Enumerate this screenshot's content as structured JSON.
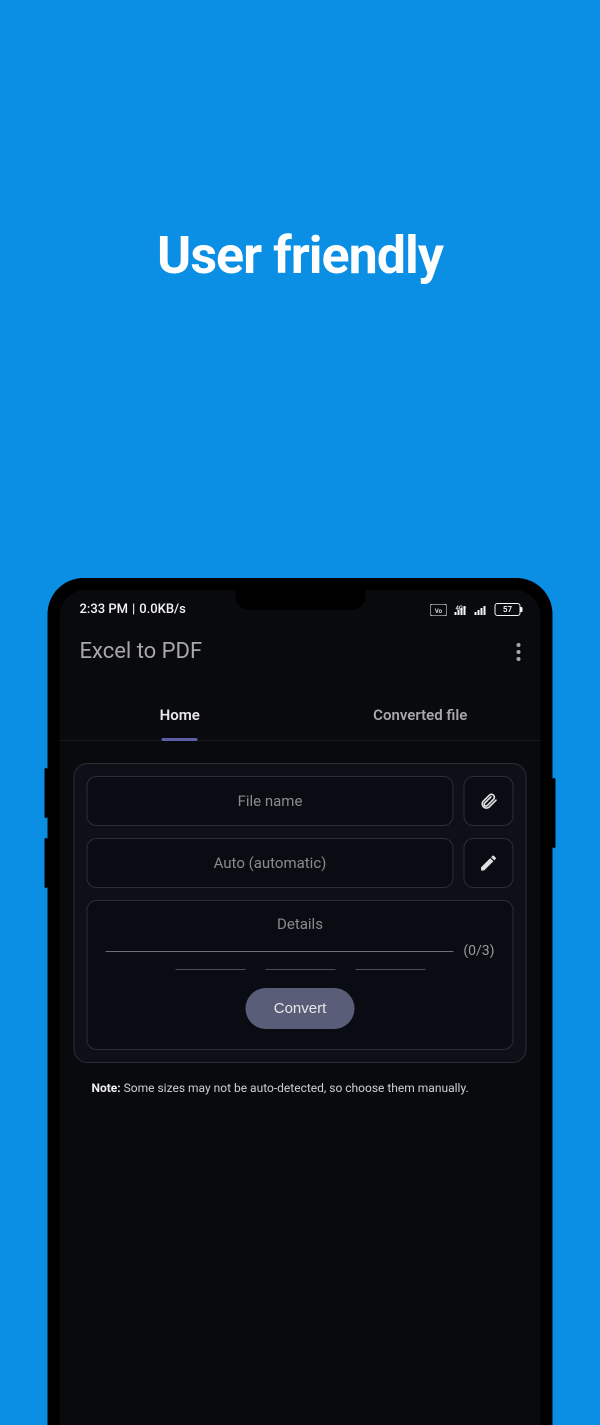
{
  "hero": {
    "title": "User friendly"
  },
  "status": {
    "time": "2:33 PM",
    "speed": "0.0KB/s",
    "battery": "57"
  },
  "app": {
    "title": "Excel to PDF"
  },
  "tabs": {
    "home": "Home",
    "converted": "Converted file"
  },
  "form": {
    "filename_placeholder": "File name",
    "mode": "Auto (automatic)",
    "details_label": "Details",
    "counter": "(0/3)",
    "convert_label": "Convert"
  },
  "note": {
    "prefix": "Note:",
    "text": " Some sizes may not be auto-detected, so choose them manually."
  }
}
